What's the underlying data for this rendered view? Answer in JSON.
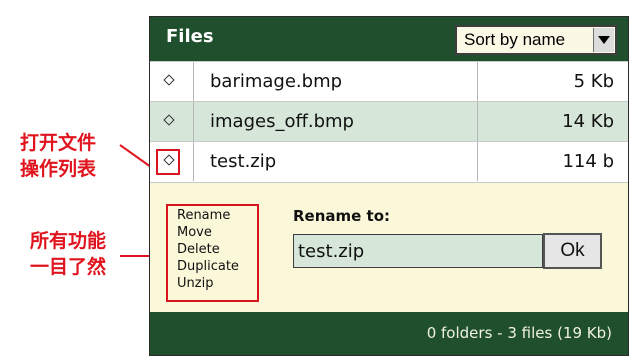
{
  "annotations": {
    "open_ops": [
      "打开文件",
      "操作列表"
    ],
    "all_funcs": [
      "所有功能",
      "一目了然"
    ]
  },
  "panel": {
    "title": "Files",
    "sort": {
      "selected": "Sort by name"
    },
    "files": [
      {
        "name": "barimage.bmp",
        "size": "5 Kb"
      },
      {
        "name": "images_off.bmp",
        "size": "14 Kb"
      },
      {
        "name": "test.zip",
        "size": "114 b"
      }
    ],
    "operations": [
      "Rename",
      "Move",
      "Delete",
      "Duplicate",
      "Unzip"
    ],
    "rename": {
      "label": "Rename to:",
      "value": "test.zip",
      "ok": "Ok"
    },
    "footer": "0 folders - 3 files (19 Kb)"
  },
  "colors": {
    "header": "#1f4f2c",
    "alt_row": "#d6e6d9",
    "ops_bg": "#fbf8d9",
    "annotation": "#e0141e"
  }
}
